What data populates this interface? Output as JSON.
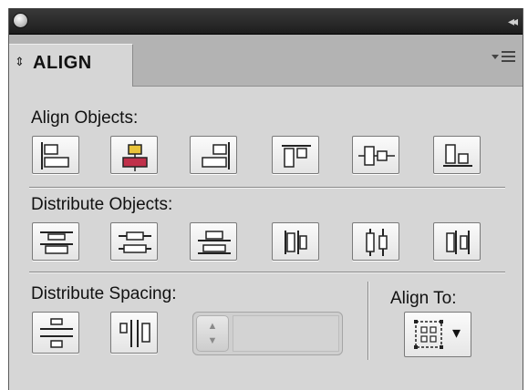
{
  "panel": {
    "tab_arrows": "⇕",
    "tab_label": "ALIGN",
    "collapse_glyph": "◂◂"
  },
  "sections": {
    "align_objects": "Align Objects:",
    "distribute_objects": "Distribute Objects:",
    "distribute_spacing": "Distribute Spacing:",
    "align_to": "Align To:"
  },
  "align_buttons": [
    {
      "name": "horizontal-align-left",
      "icon": "align-left-icon"
    },
    {
      "name": "horizontal-align-center",
      "icon": "align-horizontal-center-icon"
    },
    {
      "name": "horizontal-align-right",
      "icon": "align-right-icon"
    },
    {
      "name": "vertical-align-top",
      "icon": "align-top-icon"
    },
    {
      "name": "vertical-align-center",
      "icon": "align-vertical-center-icon"
    },
    {
      "name": "vertical-align-bottom",
      "icon": "align-bottom-icon"
    }
  ],
  "distribute_buttons": [
    {
      "name": "vertical-distribute-top",
      "icon": "distribute-top-icon"
    },
    {
      "name": "vertical-distribute-center",
      "icon": "distribute-vertical-center-icon"
    },
    {
      "name": "vertical-distribute-bottom",
      "icon": "distribute-bottom-icon"
    },
    {
      "name": "horizontal-distribute-left",
      "icon": "distribute-left-icon"
    },
    {
      "name": "horizontal-distribute-center",
      "icon": "distribute-horizontal-center-icon"
    },
    {
      "name": "horizontal-distribute-right",
      "icon": "distribute-right-icon"
    }
  ],
  "spacing_buttons": [
    {
      "name": "vertical-distribute-space",
      "icon": "distribute-vertical-space-icon"
    },
    {
      "name": "horizontal-distribute-space",
      "icon": "distribute-horizontal-space-icon"
    }
  ],
  "spacing_input": {
    "value": "",
    "up_glyph": "▲",
    "down_glyph": "▼"
  },
  "align_to": {
    "icon": "align-to-selection-icon",
    "dropdown_glyph": "▾"
  },
  "colors": {
    "panel_bg": "#d6d6d6",
    "titlebar": "#2a2a2a",
    "highlight_fill": "#e9c43a",
    "accent_red": "#c0304a"
  }
}
